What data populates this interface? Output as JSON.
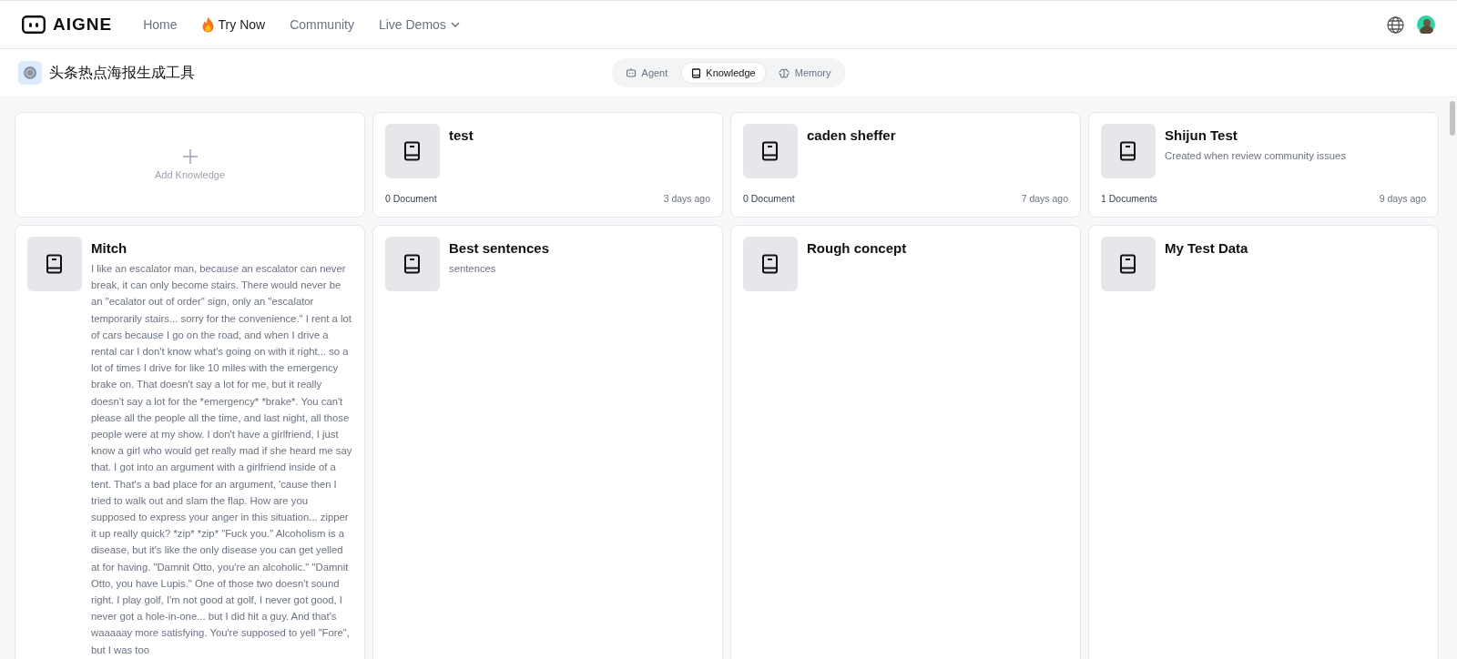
{
  "header": {
    "logo": "AIGNE",
    "nav": [
      {
        "label": "Home",
        "kind": "link"
      },
      {
        "label": "Try Now",
        "kind": "hot"
      },
      {
        "label": "Community",
        "kind": "link"
      },
      {
        "label": "Live Demos",
        "kind": "dropdown"
      }
    ]
  },
  "app": {
    "title": "头条热点海报生成工具",
    "tabs": [
      {
        "label": "Agent",
        "kind": "agent",
        "selected": false
      },
      {
        "label": "Knowledge",
        "kind": "knowledge",
        "selected": true
      },
      {
        "label": "Memory",
        "kind": "memory",
        "selected": false
      }
    ]
  },
  "knowledge": [
    {
      "kind": "add",
      "label": "Add Knowledge"
    },
    {
      "kind": "card",
      "title": "test",
      "documents": "0 Document",
      "updated": "3 days ago"
    },
    {
      "kind": "card",
      "title": "caden sheffer",
      "documents": "0 Document",
      "updated": "7 days ago"
    },
    {
      "kind": "card",
      "title": "Shijun Test",
      "description": "Created when review community issues",
      "documents": "1 Documents",
      "updated": "9 days ago"
    },
    {
      "kind": "card",
      "title": "Mitch",
      "description": "I like an escalator man, because an escalator can never break, it can only become stairs. There would never be an \"ecalator out of order\" sign, only an \"escalator temporarily stairs... sorry for the convenience.\" I rent a lot of cars because I go on the road, and when I drive a rental car I don't know what's going on with it right... so a lot of times I drive for like 10 miles with the emergency brake on. That doesn't say a lot for me, but it really doesn't say a lot for the *emergency* *brake*. You can't please all the people all the time, and last night, all those people were at my show. I don't have a girlfriend, I just know a girl who would get really mad if she heard me say that. I got into an argument with a girlfriend inside of a tent. That's a bad place for an argument, 'cause then I tried to walk out and slam the flap. How are you supposed to express your anger in this situation... zipper it up really quick? *zip* *zip* \"Fuck you.\" Alcoholism is a disease, but it's like the only disease you can get yelled at for having. \"Damnit Otto, you're an alcoholic.\" \"Damnit Otto, you have Lupis.\" One of those two doesn't sound right. I play golf, I'm not good at golf, I never got good, I never got a hole-in-one... but I did hit a guy. And that's waaaaay more satisfying. You're supposed to yell \"Fore\", but I was too"
    },
    {
      "kind": "card",
      "title": "Best sentences",
      "description": "sentences"
    },
    {
      "kind": "card",
      "title": "Rough concept"
    },
    {
      "kind": "card",
      "title": "My Test Data"
    }
  ]
}
